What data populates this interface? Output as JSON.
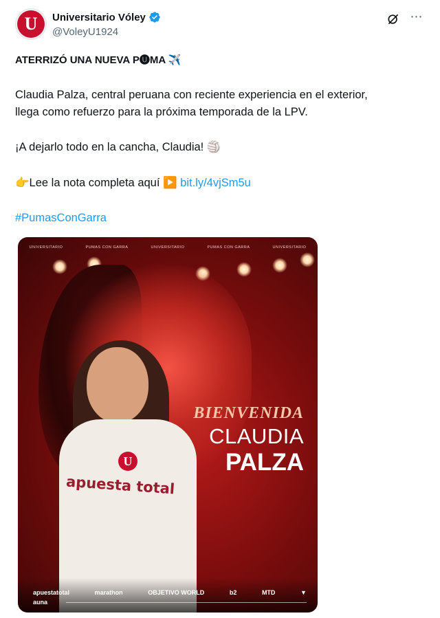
{
  "account": {
    "display_name": "Universitario Vóley",
    "handle": "@VoleyU1924",
    "avatar_letter": "U",
    "brand_color": "#c8102e",
    "verified": true
  },
  "header_icons": [
    "grok-icon",
    "more-icon"
  ],
  "tweet": {
    "headline": "ATERRIZÓ UNA NUEVA P🅤MA ✈️",
    "body_line_1": "Claudia Palza, central peruana con reciente experiencia en el exterior,",
    "body_line_2": "llega como refuerzo para la próxima temporada de la LPV.",
    "cheer": "¡A dejarlo todo en la cancha, Claudia! 🏐",
    "note_prefix": "👉Lee la nota completa aquí ▶️",
    "note_link": "bit.ly/4vjSm5u",
    "hashtag": "#PumasConGarra",
    "link_color": "#1d9bf0"
  },
  "poster": {
    "top_strip": [
      "UNIVERSITARIO",
      "PUMAS CON GARRA",
      "UNIVERSITARIO",
      "PUMAS CON GARRA",
      "UNIVERSITARIO"
    ],
    "welcome_line": "BIENVENIDA",
    "first_name": "CLAUDIA",
    "last_name": "PALZA",
    "jersey_text": "apuesta total",
    "jersey_badge": "U",
    "sponsors": [
      "apuestatotal",
      "marathon",
      "OBJETIVO WORLD",
      "b2",
      "MTD"
    ],
    "footer_sponsor": "auna"
  }
}
